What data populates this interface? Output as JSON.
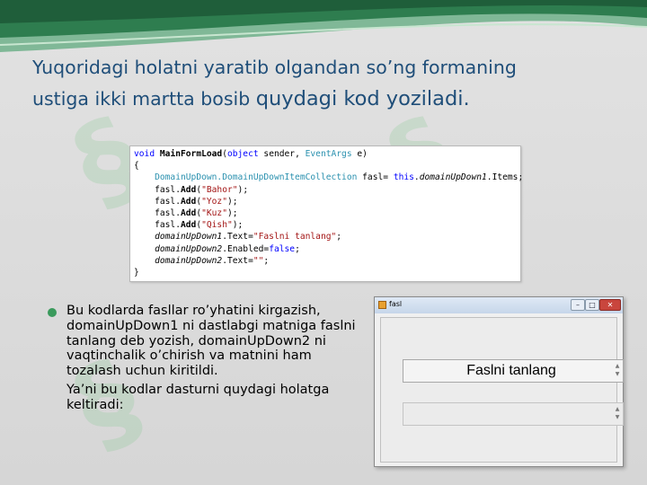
{
  "title": {
    "line1": "Yuqoridagi holatni yaratib olgandan so’ng formaning",
    "line2_normal": "ustiga ikki martta bosib ",
    "line2_large": "quydagi kod yoziladi."
  },
  "code": {
    "l1_kw": "void",
    "l1_method": "MainFormLoad",
    "l1_paren": "(",
    "l1_obj": "object",
    "l1_sender": " sender, ",
    "l1_args": "EventArgs",
    "l1_end": " e)",
    "l2": "{",
    "l3_type": "DomainUpDown.DomainUpDownItemCollection",
    "l3_var": " fasl= ",
    "l3_this": "this",
    "l3_dot": ".",
    "l3_ctrl": "domainUpDown1",
    "l3_end": ".Items;",
    "add_prefix": "fasl.",
    "add_method": "Add",
    "add_open": "(",
    "add_close": ");",
    "items": [
      "\"Bahor\"",
      "\"Yoz\"",
      "\"Kuz\"",
      "\"Qish\""
    ],
    "l8_ctrl": "domainUpDown1",
    "l8_mid": ".Text=",
    "l8_str": "\"Faslni tanlang\"",
    "l8_end": ";",
    "l9_ctrl": "domainUpDown2",
    "l9_mid": ".Enabled=",
    "l9_val": "false",
    "l9_end": ";",
    "l10_ctrl": "domainUpDown2",
    "l10_mid": ".Text=",
    "l10_str": "\"\"",
    "l10_end": ";",
    "l11": "}"
  },
  "bullet": {
    "p1": "Bu kodlarda fasllar ro’yhatini kirgazish, domainUpDown1  ni dastlabgi matniga faslni tanlang deb yozish, domainUpDown2 ni vaqtinchalik o’chirish va matnini ham tozalash uchun kiritildi.",
    "p2": "Ya’ni bu kodlar dasturni quydagi holatga keltiradi:"
  },
  "window": {
    "title": "fasl",
    "min_glyph": "–",
    "max_glyph": "□",
    "close_glyph": "✕",
    "updown1_text": "Faslni tanlang",
    "updown2_text": "",
    "arrow_up": "▲",
    "arrow_down": "▼"
  },
  "colors": {
    "title": "#1f4e79",
    "bullet_dot": "#3a9a5c",
    "band_dark": "#2e7d4f",
    "band_light": "#8cc8a0"
  }
}
